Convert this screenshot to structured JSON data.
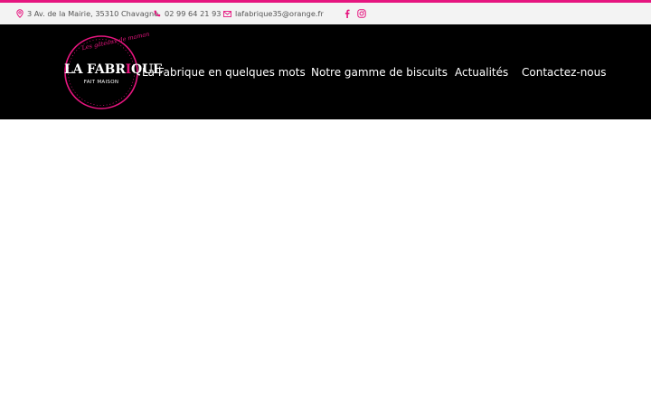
{
  "topbar": {
    "address": "3 Av. de la Mairie, 35310 Chavagne",
    "phone": "02 99 64 21 93",
    "email": "lafabrique35@orange.fr",
    "social": [
      "facebook-icon",
      "instagram-icon"
    ]
  },
  "logo": {
    "tagline": "Les gâteaux de maman",
    "brand_part1": "LA FABR",
    "brand_accent": "I",
    "brand_part2": "QUE",
    "subtitle": "FAIT MAISON"
  },
  "nav": {
    "items": [
      "La Fabrique en quelques mots",
      "Notre gamme de biscuits",
      "Actualités",
      "Contactez-nous"
    ]
  },
  "colors": {
    "accent": "#e6157f",
    "header_bg": "#000000",
    "topbar_bg": "#f3f3f3"
  }
}
